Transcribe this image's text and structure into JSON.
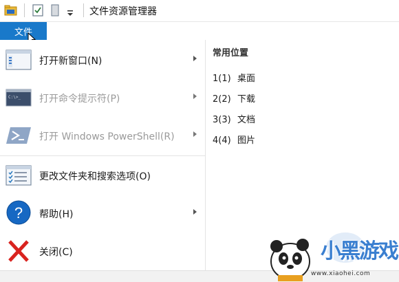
{
  "window": {
    "title": "文件资源管理器"
  },
  "ribbon": {
    "file_tab": "文件"
  },
  "file_menu": {
    "items": [
      {
        "label": "打开新窗口(N)",
        "icon": "new-window-icon",
        "disabled": false,
        "has_submenu": true
      },
      {
        "label": "打开命令提示符(P)",
        "icon": "command-prompt-icon",
        "disabled": true,
        "has_submenu": true
      },
      {
        "label": "打开 Windows PowerShell(R)",
        "icon": "powershell-icon",
        "disabled": true,
        "has_submenu": true
      },
      {
        "label": "更改文件夹和搜索选项(O)",
        "icon": "folder-options-icon",
        "disabled": false,
        "has_submenu": false
      },
      {
        "label": "帮助(H)",
        "icon": "help-icon",
        "disabled": false,
        "has_submenu": true
      },
      {
        "label": "关闭(C)",
        "icon": "close-icon",
        "disabled": false,
        "has_submenu": false
      }
    ]
  },
  "frequent_places": {
    "header": "常用位置",
    "items": [
      {
        "index": "1(1)",
        "name": "桌面"
      },
      {
        "index": "2(2)",
        "name": "下载"
      },
      {
        "index": "3(3)",
        "name": "文档"
      },
      {
        "index": "4(4)",
        "name": "图片"
      }
    ]
  },
  "watermark": {
    "brand": "小黑游戏",
    "url": "www.xiaohei.com"
  },
  "colors": {
    "accent": "#1979ca",
    "help_blue": "#1668c3",
    "close_red": "#d9231f",
    "disabled_text": "#9a9a9a"
  }
}
